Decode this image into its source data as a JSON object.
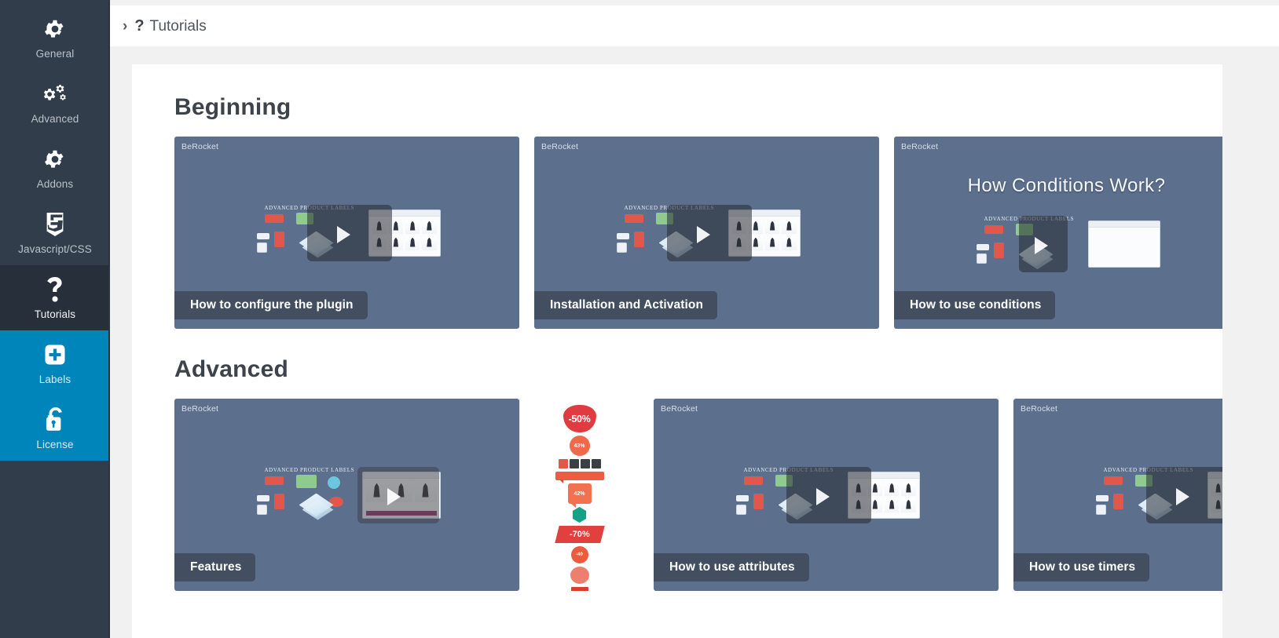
{
  "sidebar": {
    "items": [
      {
        "label": "General",
        "icon": "gear-icon",
        "active": false,
        "group": "dark"
      },
      {
        "label": "Advanced",
        "icon": "gears-icon",
        "active": false,
        "group": "dark"
      },
      {
        "label": "Addons",
        "icon": "gear-icon",
        "active": false,
        "group": "dark"
      },
      {
        "label": "Javascript/CSS",
        "icon": "css3-icon",
        "active": false,
        "group": "dark"
      },
      {
        "label": "Tutorials",
        "icon": "question-icon",
        "active": true,
        "group": "dark"
      },
      {
        "label": "Labels",
        "icon": "plus-square-icon",
        "active": false,
        "group": "blue"
      },
      {
        "label": "License",
        "icon": "unlock-icon",
        "active": false,
        "group": "blue"
      }
    ]
  },
  "breadcrumb": {
    "chevron": "›",
    "icon": "question-mark-icon",
    "icon_glyph": "?",
    "title": "Tutorials"
  },
  "sections": [
    {
      "title": "Beginning",
      "cards": [
        {
          "caption": "How to configure the plugin",
          "watermark": "BeRocket",
          "overlay_title": "",
          "thumb": "labels-grid"
        },
        {
          "caption": "Installation and Activation",
          "watermark": "BeRocket",
          "overlay_title": "",
          "thumb": "labels-grid"
        },
        {
          "caption": "How to use conditions",
          "watermark": "BeRocket",
          "overlay_title": "How Conditions Work?",
          "thumb": "conditions"
        }
      ]
    },
    {
      "title": "Advanced",
      "cards": [
        {
          "caption": "Features",
          "watermark": "BeRocket",
          "overlay_title": "",
          "thumb": "features"
        },
        {
          "caption": "How to use attributes",
          "watermark": "BeRocket",
          "overlay_title": "",
          "thumb": "labels-grid"
        },
        {
          "caption": "How to use timers",
          "watermark": "BeRocket",
          "overlay_title": "",
          "thumb": "labels-grid"
        }
      ]
    }
  ],
  "thumbnail": {
    "heading": "ADVANCED PRODUCT LABELS",
    "play_icon": "play-triangle-icon"
  },
  "label_gallery": {
    "items": [
      {
        "type": "burst",
        "text": "-50%"
      },
      {
        "type": "circle",
        "text": "43%"
      },
      {
        "type": "timer",
        "text": ""
      },
      {
        "type": "ribbon",
        "text": ""
      },
      {
        "type": "bubble",
        "text": "42%"
      },
      {
        "type": "hex",
        "text": ""
      },
      {
        "type": "paral",
        "text": "-70%"
      },
      {
        "type": "dot",
        "text": "-40"
      },
      {
        "type": "stamp",
        "text": ""
      },
      {
        "type": "box",
        "text": ""
      },
      {
        "type": "pill",
        "text": ""
      }
    ]
  },
  "colors": {
    "sidebar_bg": "#323d4c",
    "sidebar_active": "#262f3a",
    "sidebar_blue": "#0085ba",
    "card_bg": "#5c6f8c",
    "caption_bg": "#434f60",
    "page_bg": "#f1f1f1",
    "panel_bg": "#ffffff",
    "heading_color": "#3c434a"
  }
}
